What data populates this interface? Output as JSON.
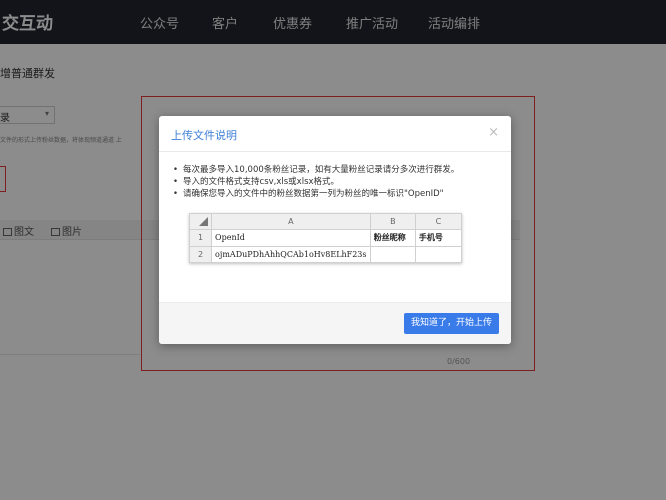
{
  "header": {
    "brand": "交互动",
    "nav": [
      "公众号",
      "客户",
      "优惠券",
      "推广活动",
      "活动编排"
    ]
  },
  "page": {
    "breadcrumb": "增普通群发",
    "select_value": "录",
    "hint": "文件的形式上传粉丝数据，将体现频道通道 上",
    "tabs": [
      "图文",
      "图片"
    ],
    "counter": "0/600"
  },
  "modal": {
    "title": "上传文件说明",
    "close": "×",
    "rules": [
      "每次最多导入10,000条粉丝记录，如有大量粉丝记录请分多次进行群发。",
      "导入的文件格式支持csv,xls或xlsx格式。",
      "请确保您导入的文件中的粉丝数据第一列为粉丝的唯一标识\"OpenID\""
    ],
    "sheet": {
      "columns": [
        "A",
        "B",
        "C"
      ],
      "rows": [
        {
          "num": "1",
          "cells": [
            "OpenId",
            "粉丝昵称",
            "手机号"
          ]
        },
        {
          "num": "2",
          "cells": [
            "ojmADuPDhAhhQCAb1oHv8ELhF23s",
            "",
            ""
          ]
        }
      ]
    },
    "confirm_button": "我知道了，开始上传"
  },
  "colors": {
    "topbar": "#22252f",
    "accent": "#3a7bea",
    "title": "#3d7fd6",
    "highlight": "#e53a3a"
  }
}
